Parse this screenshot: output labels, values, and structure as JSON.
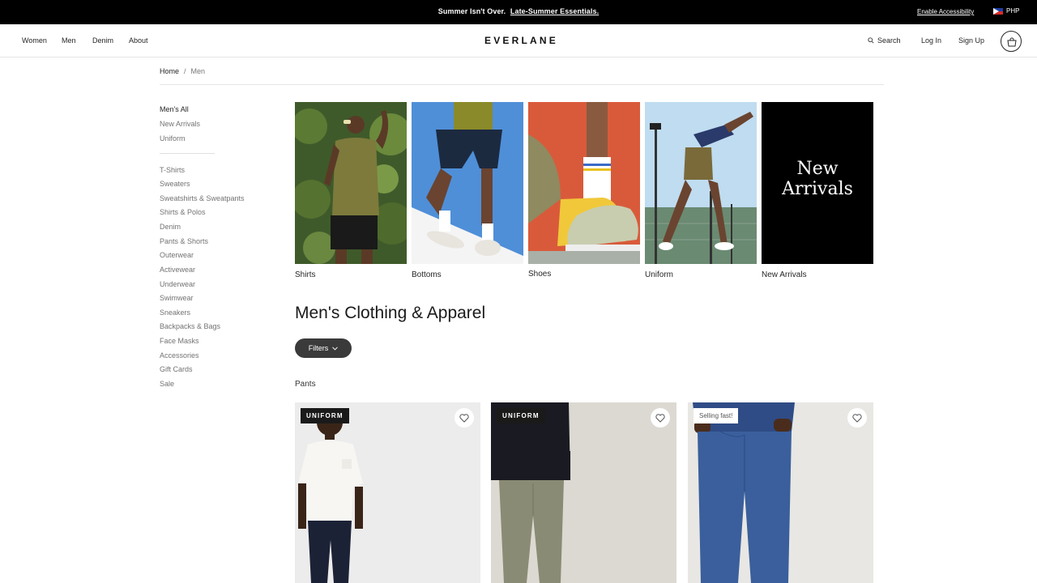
{
  "promo": {
    "lead": "Summer Isn't Over.",
    "link": "Late-Summer Essentials.",
    "accessibility": "Enable Accessibility",
    "currency": "PHP"
  },
  "header": {
    "nav": [
      "Women",
      "Men",
      "Denim",
      "About"
    ],
    "logo": "EVERLANE",
    "search": "Search",
    "login": "Log In",
    "signup": "Sign Up"
  },
  "breadcrumb": {
    "home": "Home",
    "separator": "/",
    "current": "Men"
  },
  "sidebar": {
    "top": [
      "Men's All",
      "New Arrivals",
      "Uniform"
    ],
    "categories": [
      "T-Shirts",
      "Sweaters",
      "Sweatshirts & Sweatpants",
      "Shirts & Polos",
      "Denim",
      "Pants & Shorts",
      "Outerwear",
      "Activewear",
      "Underwear",
      "Swimwear",
      "Sneakers",
      "Backpacks & Bags",
      "Face Masks",
      "Accessories",
      "Gift Cards",
      "Sale"
    ]
  },
  "tiles": [
    {
      "label": "Shirts"
    },
    {
      "label": "Bottoms"
    },
    {
      "label": "Shoes"
    },
    {
      "label": "Uniform"
    },
    {
      "label": "New Arrivals",
      "overlay_line1": "New",
      "overlay_line2": "Arrivals"
    }
  ],
  "main": {
    "title": "Men's Clothing & Apparel",
    "filters": "Filters",
    "section": "Pants"
  },
  "products": [
    {
      "badge": "UNIFORM"
    },
    {
      "badge": "UNIFORM"
    },
    {
      "badge": "Selling fast!"
    }
  ],
  "icons": {
    "search": "search-icon",
    "cart": "shopping-bag-icon",
    "wishlist": "heart-icon",
    "chevron": "chevron-down-icon",
    "flag": "philippines-flag-icon"
  }
}
